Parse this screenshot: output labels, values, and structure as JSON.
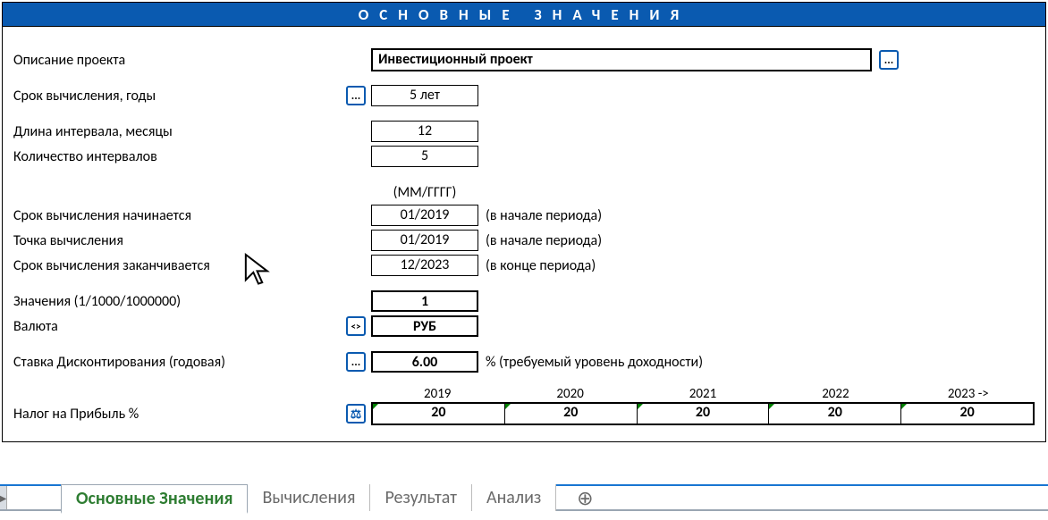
{
  "header": {
    "title": "ОСНОВНЫЕ ЗНАЧЕНИЯ"
  },
  "form": {
    "description_label": "Описание проекта",
    "description_value": "Инвестиционный проект",
    "ellipsis": "...",
    "term_years_label": "Срок вычисления, годы",
    "term_years_value": "5 лет",
    "interval_len_label": "Длина интервала, месяцы",
    "interval_len_value": "12",
    "interval_count_label": "Количество интервалов",
    "interval_count_value": "5",
    "mm_header": "(ММ/ГГГГ)",
    "start_label": "Срок вычисления начинается",
    "start_value": "01/2019",
    "start_hint": "(в начале периода)",
    "calc_point_label": "Точка вычисления",
    "calc_point_value": "01/2019",
    "calc_point_hint": "(в начале периода)",
    "end_label": "Срок вычисления заканчивается",
    "end_value": "12/2023",
    "end_hint": "(в конце периода)",
    "scale_label": "Значения (1/1000/1000000)",
    "scale_value": "1",
    "currency_label": "Валюта",
    "currency_btn": "<>",
    "currency_value": "РУБ",
    "discount_label": "Ставка Дисконтирования (годовая)",
    "discount_value": "6.00",
    "discount_hint": "% (требуемый уровень доходности)",
    "tax_label": "Налог на Прибыль %",
    "scale_icon": "⚖",
    "years": [
      "2019",
      "2020",
      "2021",
      "2022",
      "2023 ->"
    ],
    "tax_values": [
      "20",
      "20",
      "20",
      "20",
      "20"
    ]
  },
  "tabs": {
    "active": "Основные Значения",
    "items": [
      "Вычисления",
      "Результат",
      "Анализ"
    ],
    "add": "⊕"
  }
}
